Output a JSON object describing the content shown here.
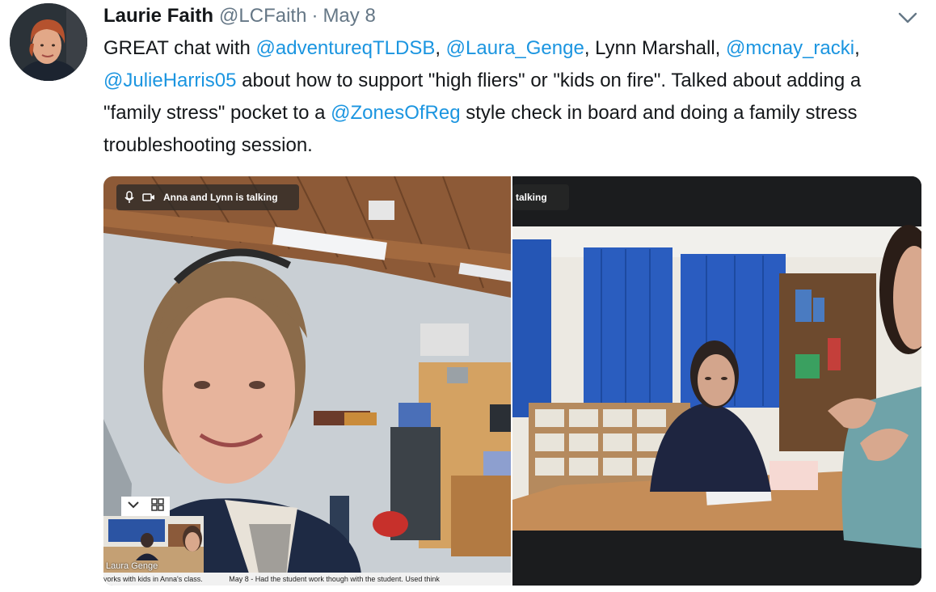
{
  "tweet": {
    "author_name": "Laurie Faith",
    "author_handle": "@LCFaith",
    "separator": "·",
    "date": "May 8",
    "menu_icon": "chevron-down-icon",
    "text_parts": [
      {
        "type": "text",
        "value": "GREAT chat with "
      },
      {
        "type": "mention",
        "value": "@adventureqTLDSB"
      },
      {
        "type": "text",
        "value": ", "
      },
      {
        "type": "mention",
        "value": "@Laura_Genge"
      },
      {
        "type": "text",
        "value": ", Lynn Marshall, "
      },
      {
        "type": "mention",
        "value": "@mcnay_racki"
      },
      {
        "type": "text",
        "value": ", "
      },
      {
        "type": "mention",
        "value": "@JulieHarris05"
      },
      {
        "type": "text",
        "value": " about how to support \"high fliers\" or \"kids on fire\". Talked about adding a \"family stress\" pocket to a "
      },
      {
        "type": "mention",
        "value": "@ZonesOfReg"
      },
      {
        "type": "text",
        "value": " style check in board and doing a family stress troubleshooting session."
      }
    ],
    "mention_color": "#1b95e0"
  },
  "media": {
    "left_overlay_text": "Anna and Lynn is talking",
    "right_overlay_text": "talking",
    "left_overlay_icons": [
      "mic-icon",
      "video-camera-icon"
    ],
    "thumbnail_controls": [
      "chevron-down-icon",
      "grid-icon"
    ],
    "thumbnail_label": "Laura Genge",
    "caption_a": "vorks with kids in Anna's class.",
    "caption_b": "May 8 - Had the student work though with the student. Used think"
  }
}
